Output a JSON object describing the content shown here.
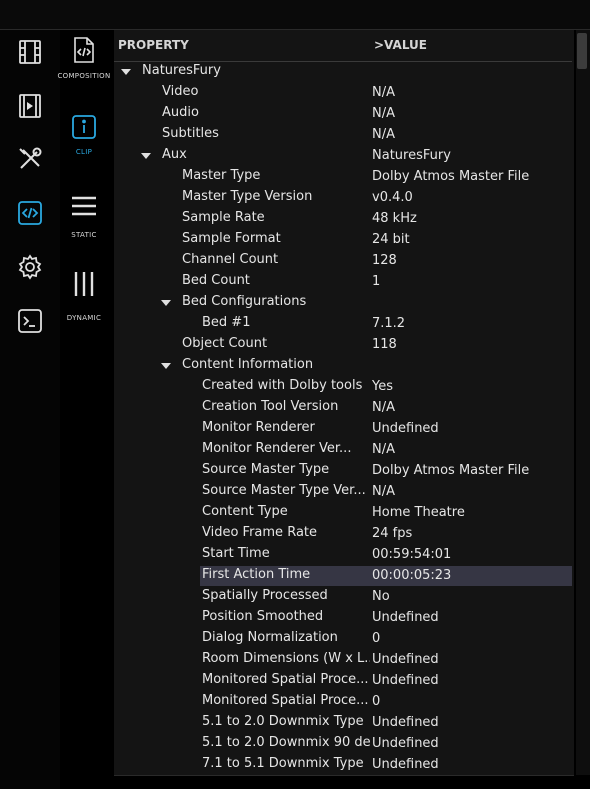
{
  "colors": {
    "accent": "#2aa8e0",
    "selected_row": "#363644",
    "panel_bg": "#141414"
  },
  "sidebar": {
    "icons": [
      {
        "name": "film-icon"
      },
      {
        "name": "video-clip-icon"
      },
      {
        "name": "tools-icon"
      },
      {
        "name": "code-icon",
        "active": true
      },
      {
        "name": "gear-icon"
      },
      {
        "name": "terminal-icon"
      }
    ]
  },
  "modes": {
    "composition": "COMPOSITION",
    "clip": "CLIP",
    "static": "STATIC",
    "dynamic": "DYNAMIC",
    "active": "clip"
  },
  "table": {
    "header": {
      "property": "PROPERTY",
      "value": ">VALUE"
    },
    "rows": [
      {
        "label": "NaturesFury",
        "value": "",
        "level": 0,
        "expander": true
      },
      {
        "label": "Video",
        "value": "N/A",
        "level": 1
      },
      {
        "label": "Audio",
        "value": "N/A",
        "level": 1
      },
      {
        "label": "Subtitles",
        "value": "N/A",
        "level": 1
      },
      {
        "label": "Aux",
        "value": "NaturesFury",
        "level": 1,
        "expander": true
      },
      {
        "label": "Master Type",
        "value": "Dolby Atmos Master File",
        "level": 2
      },
      {
        "label": "Master Type Version",
        "value": "v0.4.0",
        "level": 2
      },
      {
        "label": "Sample Rate",
        "value": "48 kHz",
        "level": 2
      },
      {
        "label": "Sample Format",
        "value": "24 bit",
        "level": 2
      },
      {
        "label": "Channel Count",
        "value": "128",
        "level": 2
      },
      {
        "label": "Bed Count",
        "value": "1",
        "level": 2
      },
      {
        "label": "Bed Configurations",
        "value": "",
        "level": 2,
        "expander": true
      },
      {
        "label": "Bed #1",
        "value": "7.1.2",
        "level": 3
      },
      {
        "label": "Object Count",
        "value": "118",
        "level": 2
      },
      {
        "label": "Content Information",
        "value": "",
        "level": 2,
        "expander": true
      },
      {
        "label": "Created with Dolby tools",
        "value": "Yes",
        "level": 3
      },
      {
        "label": "Creation Tool Version",
        "value": "N/A",
        "level": 3
      },
      {
        "label": "Monitor Renderer",
        "value": "Undefined",
        "level": 3
      },
      {
        "label": "Monitor Renderer Ver...",
        "value": "N/A",
        "level": 3
      },
      {
        "label": "Source Master Type",
        "value": "Dolby Atmos Master File",
        "level": 3
      },
      {
        "label": "Source Master Type Ver...",
        "value": "N/A",
        "level": 3
      },
      {
        "label": "Content Type",
        "value": "Home Theatre",
        "level": 3
      },
      {
        "label": "Video Frame Rate",
        "value": "24 fps",
        "level": 3
      },
      {
        "label": "Start Time",
        "value": "00:59:54:01",
        "level": 3
      },
      {
        "label": "First Action Time",
        "value": "00:00:05:23",
        "level": 3,
        "selected": true
      },
      {
        "label": "Spatially Processed",
        "value": "No",
        "level": 3
      },
      {
        "label": "Position Smoothed",
        "value": "Undefined",
        "level": 3
      },
      {
        "label": "Dialog Normalization",
        "value": "0",
        "level": 3
      },
      {
        "label": "Room Dimensions (W x L...",
        "value": "Undefined",
        "level": 3
      },
      {
        "label": "Monitored Spatial Proce...",
        "value": "Undefined",
        "level": 3
      },
      {
        "label": "Monitored Spatial Proce...",
        "value": "0",
        "level": 3
      },
      {
        "label": "5.1 to 2.0 Downmix Type",
        "value": "Undefined",
        "level": 3
      },
      {
        "label": "5.1 to 2.0 Downmix 90 de...",
        "value": "Undefined",
        "level": 3
      },
      {
        "label": "7.1 to 5.1 Downmix Type",
        "value": "Undefined",
        "level": 3
      }
    ]
  }
}
